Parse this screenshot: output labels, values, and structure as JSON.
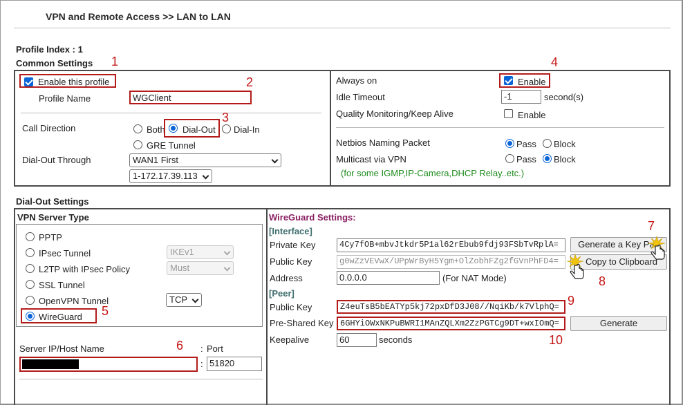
{
  "page": {
    "title": "VPN and Remote Access >> LAN to LAN"
  },
  "profile": {
    "index_label": "Profile Index : 1"
  },
  "common": {
    "heading": "Common Settings",
    "enable_profile_label": "Enable this profile",
    "enable_profile_checked": true,
    "profile_name_label": "Profile Name",
    "profile_name_value": "WGClient",
    "call_direction_label": "Call Direction",
    "call_options": [
      "Both",
      "Dial-Out",
      "Dial-In"
    ],
    "call_selected": "Dial-Out",
    "gre_label": "GRE Tunnel",
    "dialout_through_label": "Dial-Out Through",
    "dialout_through_value": "WAN1 First",
    "ip_select_value": "1-172.17.39.113",
    "always_on_label": "Always on",
    "always_on_enable_label": "Enable",
    "always_on_checked": true,
    "idle_timeout_label": "Idle Timeout",
    "idle_timeout_value": "-1",
    "idle_unit": "second(s)",
    "qm_label": "Quality Monitoring/Keep Alive",
    "qm_enable_label": "Enable",
    "qm_checked": false,
    "netbios_label": "Netbios Naming Packet",
    "netbios_pass": "Pass",
    "netbios_block": "Block",
    "netbios_selected": "Pass",
    "multicast_label": "Multicast via VPN",
    "multicast_pass": "Pass",
    "multicast_block": "Block",
    "multicast_selected": "Block",
    "multicast_note": "(for some IGMP,IP-Camera,DHCP Relay..etc.)"
  },
  "dialout": {
    "heading": "Dial-Out Settings",
    "server_type_heading": "VPN Server Type",
    "types": [
      "PPTP",
      "IPsec Tunnel",
      "L2TP with IPsec Policy",
      "SSL Tunnel",
      "OpenVPN Tunnel",
      "WireGuard"
    ],
    "type_selected": "WireGuard",
    "ike_select": "IKEv1",
    "must_select": "Must",
    "openvpn_proto": "TCP",
    "server_host_label": "Server IP/Host Name",
    "port_label": "Port",
    "port_colon": ":",
    "port_value": "51820"
  },
  "wireguard": {
    "heading": "WireGuard Settings:",
    "interface_heading": "[Interface]",
    "private_key_label": "Private Key",
    "private_key_value": "4Cy7fOB+mbvJtkdr5P1al62rEbub9fdj93FSbTvRplA=",
    "public_key_label": "Public Key",
    "public_key_value": "g0wZzVEVwX/UPpWrByH5Ygm+OlZobhFZg2fGVnPhFD4=",
    "address_label": "Address",
    "address_value": "0.0.0.0",
    "address_note": "(For NAT Mode)",
    "generate_keypair_button": "Generate a Key Pair",
    "copy_clipboard_button": "Copy to Clipboard",
    "peer_heading": "[Peer]",
    "peer_public_key_label": "Public Key",
    "peer_public_key_value": "Z4euTsB5bEATYp5kj72pxDfD3J08//NqiKb/k7VlphQ=",
    "psk_label": "Pre-Shared Key",
    "psk_value": "6GHYiOWxNKPuBWRI1MAnZQLXm2ZzPGTCg9DT+wxIOmQ=",
    "generate_button": "Generate",
    "keepalive_label": "Keepalive",
    "keepalive_value": "60",
    "keepalive_unit": "seconds"
  },
  "callouts": [
    "1",
    "2",
    "3",
    "4",
    "5",
    "6",
    "7",
    "8",
    "9",
    "10"
  ],
  "colors": {
    "accent": "#0a64d6",
    "callout_red": "#b31b1b",
    "wireguard_heading": "#8a2163",
    "note_green": "#1c8a1c"
  }
}
